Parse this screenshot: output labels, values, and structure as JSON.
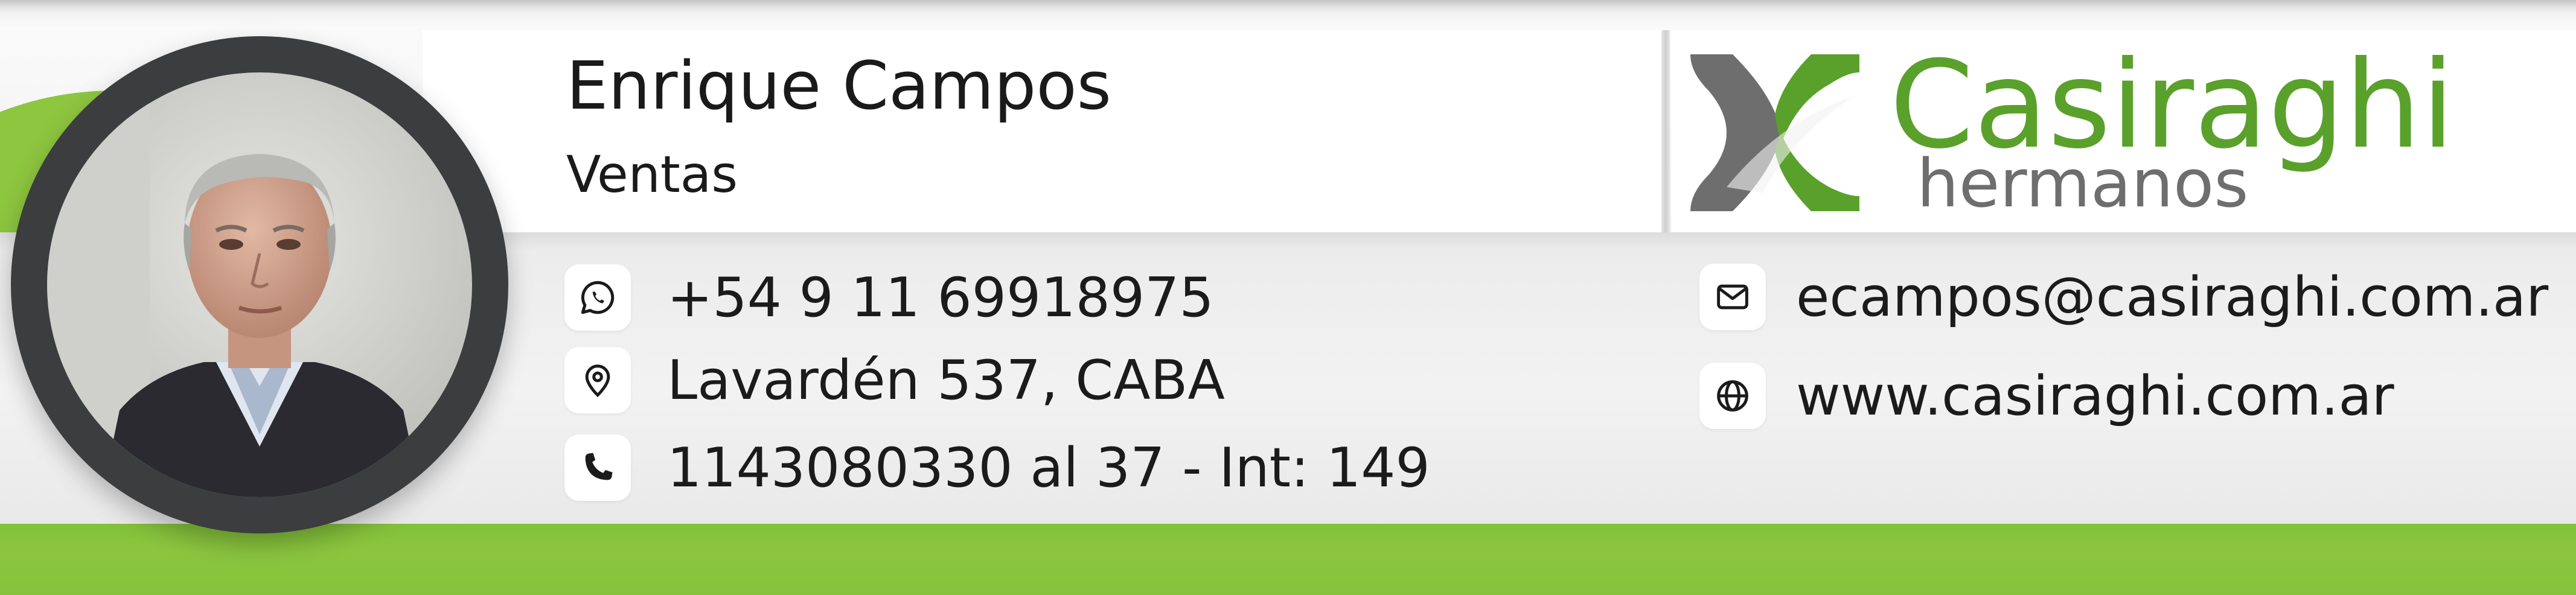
{
  "person": {
    "name": "Enrique Campos",
    "role": "Ventas"
  },
  "contact": {
    "whatsapp": "+54 9 11 69918975",
    "address": "Lavardén 537, CABA",
    "phone": "1143080330 al 37  - Int: 149",
    "email": "ecampos@casiraghi.com.ar",
    "website": "www.casiraghi.com.ar"
  },
  "logo": {
    "brand": "Casiraghi",
    "sub": "hermanos"
  },
  "icons": {
    "whatsapp": "whatsapp-icon",
    "address": "location-pin-icon",
    "phone": "phone-icon",
    "email": "envelope-icon",
    "website": "globe-icon"
  },
  "colors": {
    "brand_green": "#8dc63f",
    "logo_green": "#5aa12c",
    "logo_gray": "#6e6e6e",
    "ring": "#3b3d3f",
    "text": "#1a1a1a"
  }
}
